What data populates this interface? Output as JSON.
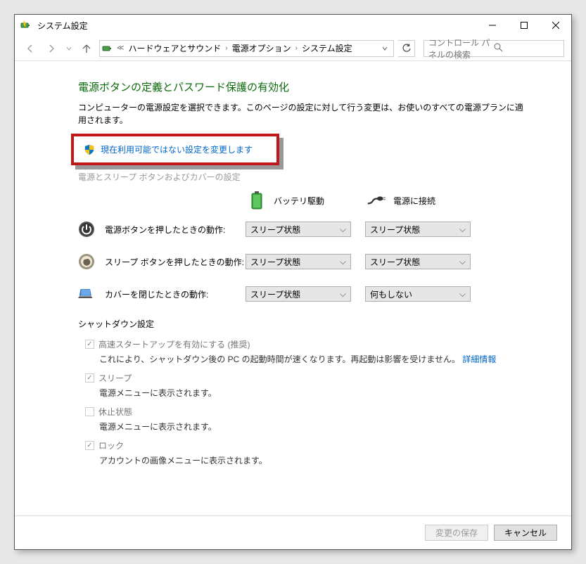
{
  "title": "システム設定",
  "breadcrumb": {
    "items": [
      "ハードウェアとサウンド",
      "電源オプション",
      "システム設定"
    ]
  },
  "search": {
    "placeholder": "コントロール パネルの検索"
  },
  "page": {
    "heading": "電源ボタンの定義とパスワード保護の有効化",
    "description": "コンピューターの電源設定を選択できます。このページの設定に対して行う変更は、お使いのすべての電源プランに適用されます。",
    "change_link": "現在利用可能ではない設定を変更します",
    "section1": "電源とスリープ ボタンおよびカバーの設定",
    "col_battery": "バッテリ駆動",
    "col_ac": "電源に接続",
    "rows": [
      {
        "label": "電源ボタンを押したときの動作:",
        "battery": "スリープ状態",
        "ac": "スリープ状態"
      },
      {
        "label": "スリープ ボタンを押したときの動作:",
        "battery": "スリープ状態",
        "ac": "スリープ状態"
      },
      {
        "label": "カバーを閉じたときの動作:",
        "battery": "スリープ状態",
        "ac": "何もしない"
      }
    ],
    "shutdown_heading": "シャットダウン設定",
    "checks": [
      {
        "label": "高速スタートアップを有効にする (推奨)",
        "checked": true,
        "sub": "これにより、シャットダウン後の PC の起動時間が速くなります。再起動は影響を受けません。",
        "link": "詳細情報"
      },
      {
        "label": "スリープ",
        "checked": true,
        "sub": "電源メニューに表示されます。"
      },
      {
        "label": "休止状態",
        "checked": false,
        "sub": "電源メニューに表示されます。"
      },
      {
        "label": "ロック",
        "checked": true,
        "sub": "アカウントの画像メニューに表示されます。"
      }
    ]
  },
  "footer": {
    "save": "変更の保存",
    "cancel": "キャンセル"
  }
}
